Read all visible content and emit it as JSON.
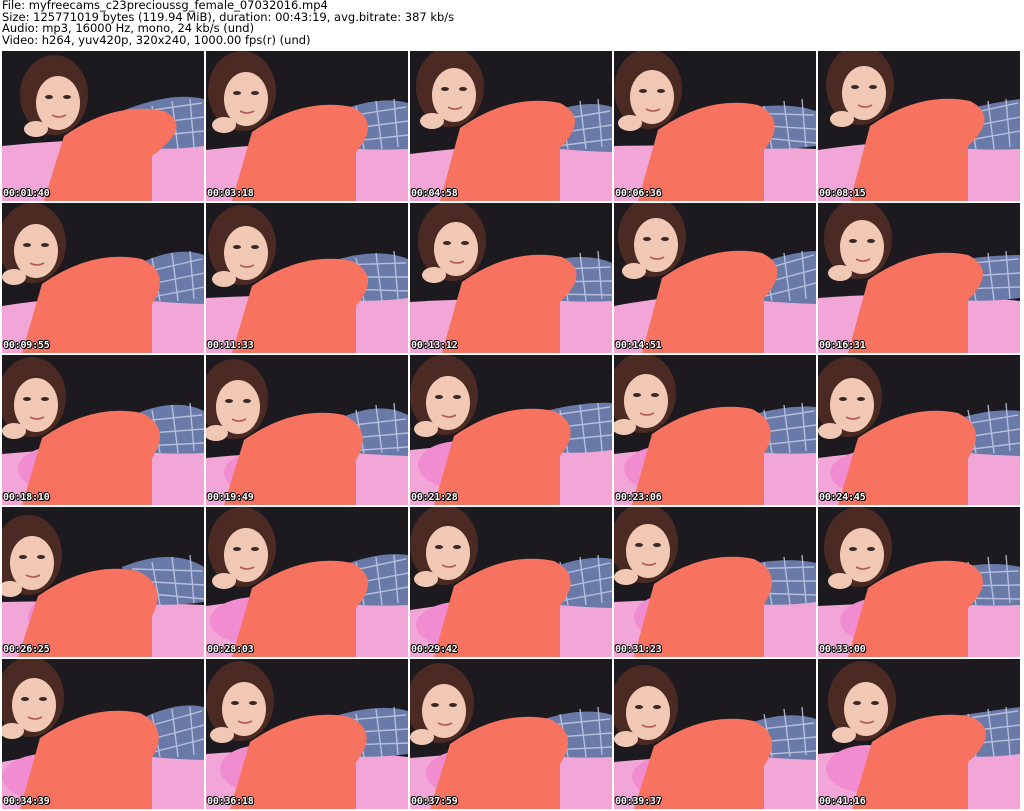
{
  "header": {
    "file_line": "File: myfreecams_c23precioussg_female_07032016.mp4",
    "size_line": "Size: 125771019 bytes (119.94 MiB), duration: 00:43:19, avg.bitrate: 387 kb/s",
    "audio_line": "Audio: mp3, 16000 Hz, mono, 24 kb/s (und)",
    "video_line": "Video: h264, yuv420p, 320x240, 1000.00 fps(r) (und)"
  },
  "thumbnails": [
    {
      "timestamp": "00:01:40"
    },
    {
      "timestamp": "00:03:18"
    },
    {
      "timestamp": "00:04:58"
    },
    {
      "timestamp": "00:06:36"
    },
    {
      "timestamp": "00:08:15"
    },
    {
      "timestamp": "00:09:55"
    },
    {
      "timestamp": "00:11:33"
    },
    {
      "timestamp": "00:13:12"
    },
    {
      "timestamp": "00:14:51"
    },
    {
      "timestamp": "00:16:31"
    },
    {
      "timestamp": "00:18:10"
    },
    {
      "timestamp": "00:19:49"
    },
    {
      "timestamp": "00:21:28"
    },
    {
      "timestamp": "00:23:06"
    },
    {
      "timestamp": "00:24:45"
    },
    {
      "timestamp": "00:26:25"
    },
    {
      "timestamp": "00:28:03"
    },
    {
      "timestamp": "00:29:42"
    },
    {
      "timestamp": "00:31:23"
    },
    {
      "timestamp": "00:33:00"
    },
    {
      "timestamp": "00:34:39"
    },
    {
      "timestamp": "00:36:18"
    },
    {
      "timestamp": "00:37:59"
    },
    {
      "timestamp": "00:39:37"
    },
    {
      "timestamp": "00:41:16"
    }
  ],
  "colors": {
    "background": "#ffffff",
    "header_text": "#000000",
    "frame_backdrop": "#1c1a1e",
    "bedding": "#f2a6d8",
    "shirt": "#f7725f",
    "pillow": "#f08ccf",
    "hair": "#4a2a22",
    "skin": "#f0c8b4",
    "pants": "#6a7aa8",
    "timestamp_text": "#ffffff"
  }
}
